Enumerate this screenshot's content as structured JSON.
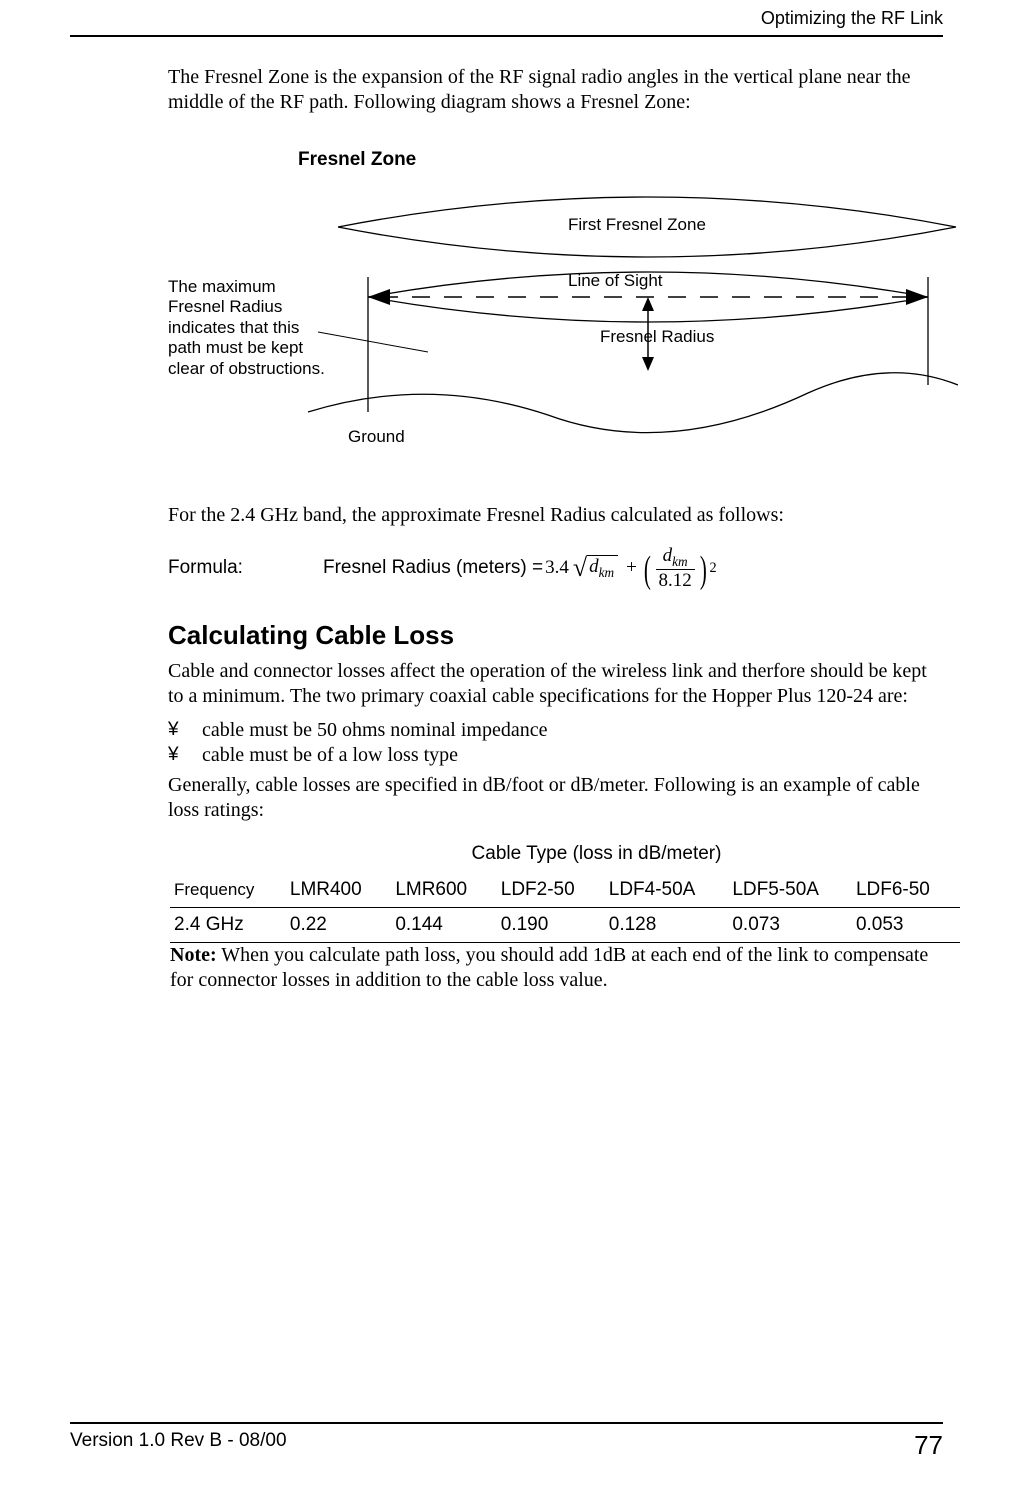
{
  "header": {
    "title": "Optimizing the RF Link"
  },
  "intro": "The Fresnel Zone is the expansion of the RF signal radio angles in the vertical plane near the middle of the RF path. Following diagram shows a Fresnel Zone:",
  "figure": {
    "title": "Fresnel Zone",
    "note": "The maximum Fresnel Radius indicates that this path must be kept clear of obstructions.",
    "first_zone": "First Fresnel Zone",
    "line_of_sight": "Line of Sight",
    "radius": "Fresnel Radius",
    "ground": "Ground"
  },
  "after_fig": "For the 2.4 GHz band, the approximate Fresnel Radius calculated as follows:",
  "formula": {
    "label": "Formula:",
    "lhs": "Fresnel Radius (meters) =",
    "coef": "3.4",
    "var": "d",
    "var_sub": "km",
    "den": "8.12"
  },
  "cable": {
    "heading": "Calculating Cable Loss",
    "p1": "Cable and connector losses affect the operation of the wireless link and therfore should be kept to a minimum. The two primary coaxial cable specifications for the Hopper Plus 120-24 are:",
    "b1": "cable must be 50 ohms nominal impedance",
    "b2": "cable must be of a low loss type",
    "p2": "Generally, cable losses are specified in dB/foot or dB/meter. Following is an example of cable loss ratings:"
  },
  "table": {
    "caption": "Cable Type (loss in dB/meter)",
    "headers": [
      "Frequency",
      "LMR400",
      "LMR600",
      "LDF2-50",
      "LDF4-50A",
      "LDF5-50A",
      "LDF6-50"
    ],
    "row": [
      "2.4 GHz",
      "0.22",
      "0.144",
      "0.190",
      "0.128",
      "0.073",
      "0.053"
    ]
  },
  "note_label": "Note:",
  "note": " When you calculate path loss, you should add 1dB at each end of the link to compensate for connector losses in addition to the cable loss value.",
  "footer": {
    "version": "Version 1.0 Rev B - 08/00",
    "page": "77"
  },
  "chart_data": {
    "type": "table",
    "title": "Cable Type (loss in dB/meter)",
    "xlabel": "Cable Type",
    "ylabel": "Loss (dB/meter) at 2.4 GHz",
    "categories": [
      "LMR400",
      "LMR600",
      "LDF2-50",
      "LDF4-50A",
      "LDF5-50A",
      "LDF6-50"
    ],
    "values": [
      0.22,
      0.144,
      0.19,
      0.128,
      0.073,
      0.053
    ]
  }
}
